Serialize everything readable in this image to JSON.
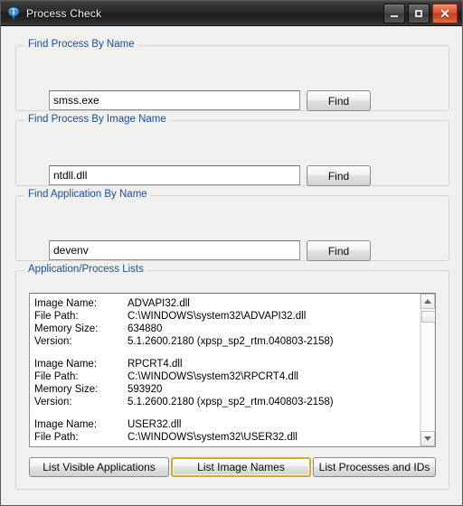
{
  "window": {
    "title": "Process Check",
    "icon": "info-balloon-icon",
    "controls": {
      "minimize": "Minimize",
      "maximize": "Maximize",
      "close": "Close"
    },
    "accent_color": "#1a4fa0",
    "focus_border_color": "#d9a43a"
  },
  "groups": [
    {
      "legend": "Find Process By Name",
      "input_value": "smss.exe",
      "input_placeholder": "",
      "button_label": "Find"
    },
    {
      "legend": "Find Process By Image Name",
      "input_value": "ntdll.dll",
      "input_placeholder": "",
      "button_label": "Find"
    },
    {
      "legend": "Find Application By Name",
      "input_value": "devenv",
      "input_placeholder": "",
      "button_label": "Find"
    }
  ],
  "lists_group": {
    "legend": "Application/Process Lists",
    "labels": {
      "image_name": "Image Name:",
      "file_path": "File Path:",
      "memory_size": "Memory Size:",
      "version": "Version:"
    },
    "entries": [
      {
        "image_name": "ADVAPI32.dll",
        "file_path": "C:\\WINDOWS\\system32\\ADVAPI32.dll",
        "memory_size": "634880",
        "version": "5.1.2600.2180 (xpsp_sp2_rtm.040803-2158)"
      },
      {
        "image_name": "RPCRT4.dll",
        "file_path": "C:\\WINDOWS\\system32\\RPCRT4.dll",
        "memory_size": "593920",
        "version": "5.1.2600.2180 (xpsp_sp2_rtm.040803-2158)"
      },
      {
        "image_name": "USER32.dll",
        "file_path": "C:\\WINDOWS\\system32\\USER32.dll",
        "memory_size": "",
        "version": ""
      }
    ],
    "buttons": [
      {
        "label": "List Visible Applications",
        "focused": false
      },
      {
        "label": "List Image Names",
        "focused": true
      },
      {
        "label": "List Processes and IDs",
        "focused": false
      }
    ]
  }
}
